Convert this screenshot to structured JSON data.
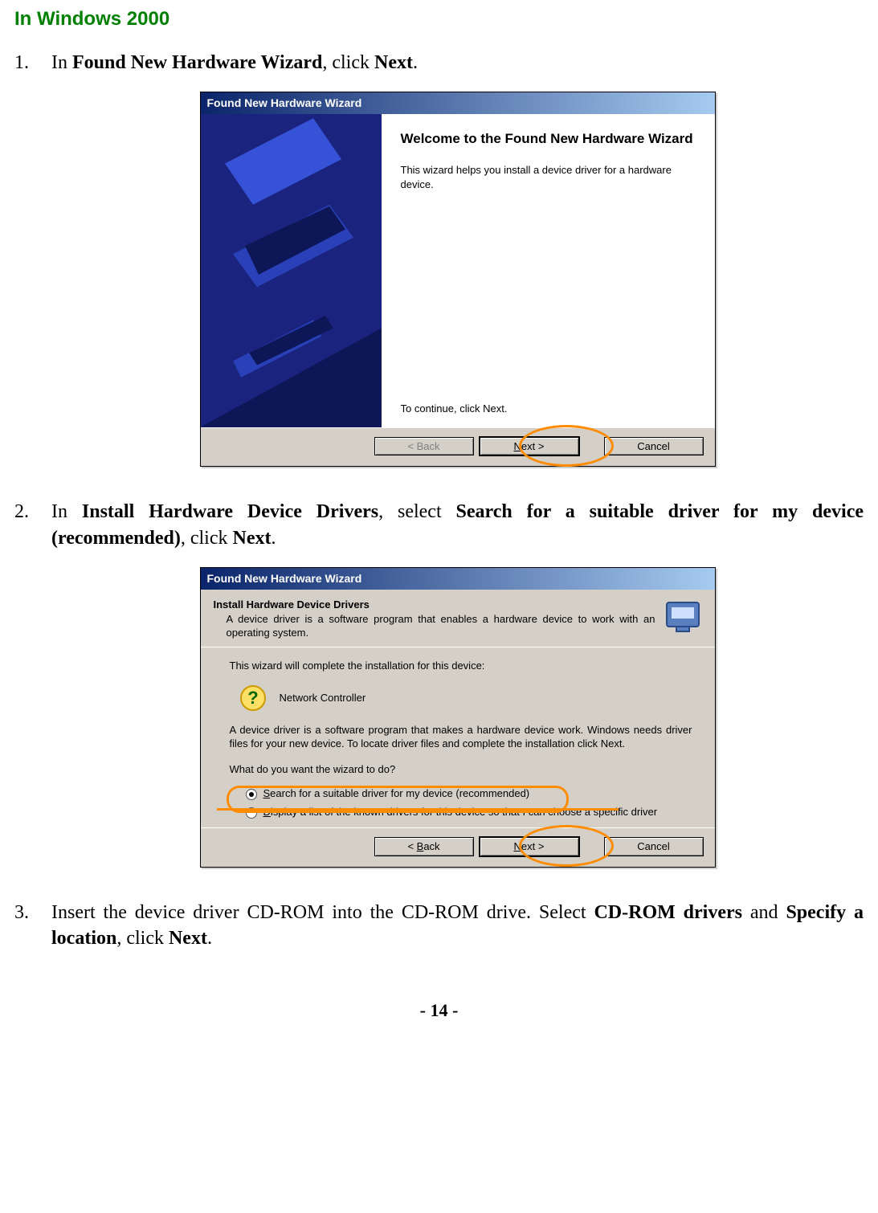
{
  "heading": "In Windows 2000",
  "steps": {
    "s1_prefix": "In ",
    "s1_b1": "Found New Hardware Wizard",
    "s1_mid": ", click ",
    "s1_b2": "Next",
    "s1_suffix": ".",
    "s2_prefix": "In ",
    "s2_b1": "Install Hardware Device Drivers",
    "s2_mid1": ", select ",
    "s2_b2": "Search for a suitable driver for my device (recommended)",
    "s2_mid2": ", click ",
    "s2_b3": "Next",
    "s2_suffix": ".",
    "s3_prefix": "Insert the device driver CD-ROM into the CD-ROM drive. Select ",
    "s3_b1": "CD-ROM drivers",
    "s3_mid1": " and ",
    "s3_b2": "Specify a location",
    "s3_mid2": ", click ",
    "s3_b3": "Next",
    "s3_suffix": "."
  },
  "dlg1": {
    "title": "Found New Hardware Wizard",
    "welcome_title": "Welcome to the Found New Hardware Wizard",
    "welcome_info": "This wizard helps you install a device driver for a hardware device.",
    "continue": "To continue, click Next.",
    "back": "< Back",
    "next": "Next >",
    "cancel": "Cancel"
  },
  "dlg2": {
    "title": "Found New Hardware Wizard",
    "hdr_bold": "Install Hardware Device Drivers",
    "hdr_sub": "A device driver is a software program that enables a hardware device to work with an operating system.",
    "line1": "This wizard will complete the installation for this device:",
    "device": "Network Controller",
    "line2": "A device driver is a software program that makes a hardware device work. Windows needs driver files for your new device. To locate driver files and complete the installation click Next.",
    "prompt": "What do you want the wizard to do?",
    "opt1_a": "S",
    "opt1_b": "earch for a suitable driver for my device (recommended)",
    "opt2_a": "D",
    "opt2_b": "isplay a list of the known drivers for this device so that I can choose a specific driver",
    "back_a": "< ",
    "back_b": "B",
    "back_c": "ack",
    "next_a": "N",
    "next_b": "ext >",
    "cancel": "Cancel"
  },
  "page_number": "- 14 -"
}
